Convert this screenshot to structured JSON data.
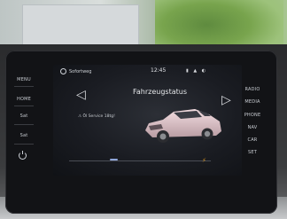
{
  "left_buttons": [
    {
      "label": "MENU"
    },
    {
      "label": "HOME"
    },
    {
      "label": "Sat"
    },
    {
      "label": "Sat"
    }
  ],
  "right_buttons": [
    {
      "label": "RADIO"
    },
    {
      "label": "MEDIA"
    },
    {
      "label": "PHONE"
    },
    {
      "label": "NAV"
    },
    {
      "label": "CAR"
    },
    {
      "label": "SET"
    }
  ],
  "screen": {
    "status_text": "Sofortweg",
    "time": "12:45",
    "title": "Fahrzeugstatus",
    "service_text": "Öl Service 18tg!",
    "car_color": "#e7c9cf"
  }
}
